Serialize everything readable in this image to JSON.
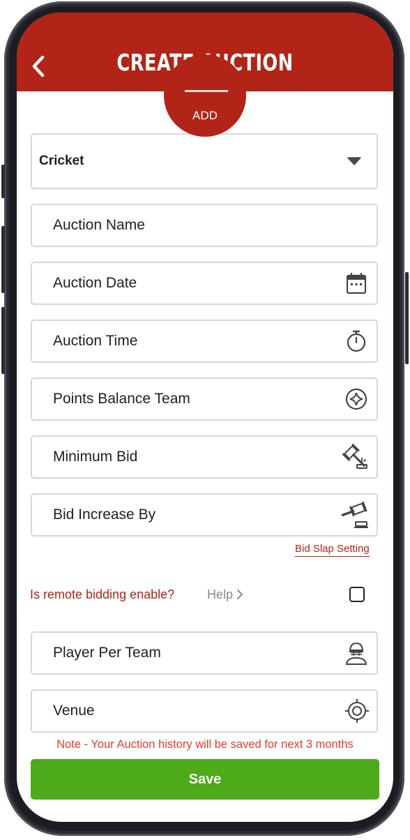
{
  "header": {
    "title": "CREATE AUCTION",
    "add_label": "ADD",
    "back_icon": "chevron-left-icon"
  },
  "form": {
    "sport_select": {
      "value": "Cricket",
      "icon": "caret-down-icon"
    },
    "fields": [
      {
        "placeholder": "Auction Name",
        "icon": ""
      },
      {
        "placeholder": "Auction Date",
        "icon": "calendar-icon"
      },
      {
        "placeholder": "Auction Time",
        "icon": "stopwatch-icon"
      },
      {
        "placeholder": "Points Balance Team",
        "icon": "sparkle-circle-icon"
      },
      {
        "placeholder": "Minimum Bid",
        "icon": "gavel-bid-icon"
      },
      {
        "placeholder": "Bid Increase By",
        "icon": "gavel-icon"
      },
      {
        "placeholder": "Player Per Team",
        "icon": "cricket-player-icon"
      },
      {
        "placeholder": "Venue",
        "icon": "location-target-icon"
      }
    ],
    "bid_slap_setting": "Bid Slap Setting",
    "remote_bidding": {
      "question": "Is remote bidding enable?",
      "help": "Help",
      "checked": false
    },
    "note": "Note - Your Auction history will be saved for next 3 months",
    "save_label": "Save"
  },
  "colors": {
    "header_red": "#b12417",
    "save_green": "#4caa1b",
    "note_red": "#e53a2d"
  }
}
